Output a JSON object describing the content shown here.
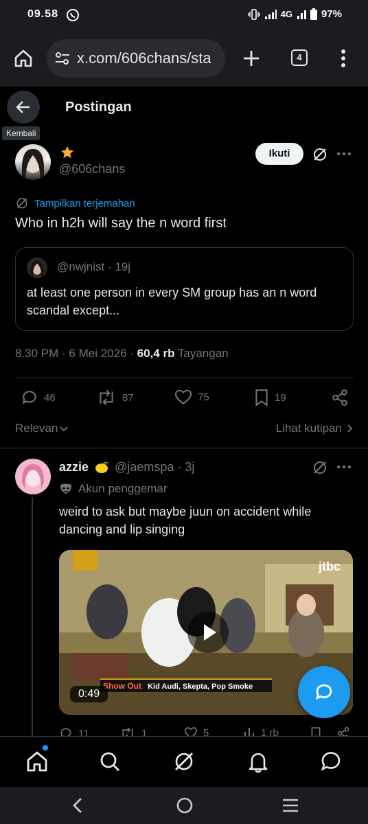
{
  "status_bar": {
    "time": "09.58",
    "network": "4G",
    "battery": "97%"
  },
  "browser": {
    "url": "x.com/606chans/sta",
    "tab_count": "4"
  },
  "header": {
    "title": "Postingan",
    "back_tooltip": "Kembali"
  },
  "post": {
    "handle": "@606chans",
    "follow_label": "Ikuti",
    "translate_label": "Tampilkan terjemahan",
    "text": "Who in h2h will say the n word first",
    "quote": {
      "handle_time": "@nwjnist · 19j",
      "text": "at least one person in every SM group has an n word scandal except..."
    },
    "meta": {
      "time_date": "8.30 PM · 6 Mei 2026 · ",
      "views": "60,4 rb",
      "views_label": "Tayangan"
    },
    "actions": {
      "replies": "46",
      "reposts": "87",
      "likes": "75",
      "bookmarks": "19"
    }
  },
  "sort": {
    "relevance_label": "Relevan",
    "quotes_label": "Lihat kutipan"
  },
  "reply": {
    "name": "azzie",
    "handle_time": "@jaemspa · 3j",
    "fan_label": "Akun penggemar",
    "text": "weird to ask but maybe juun on accident while dancing and lip singing",
    "video": {
      "duration": "0:49",
      "banner_title": "Show Out",
      "banner_artists": "Kid Audi, Skepta, Pop Smoke",
      "channel": "jtbc"
    },
    "actions": {
      "replies": "11",
      "reposts": "1",
      "likes": "5",
      "views": "1 rb"
    }
  },
  "colors": {
    "accent": "#1d9bf0",
    "background": "#000000",
    "muted": "#71767b",
    "text": "#e7e9ea"
  },
  "icons": {
    "bottom_nav": [
      "home-icon",
      "search-icon",
      "grok-icon",
      "notifications-icon",
      "messages-icon"
    ],
    "android_nav": [
      "android-back-icon",
      "android-home-icon",
      "android-recents-icon"
    ]
  }
}
